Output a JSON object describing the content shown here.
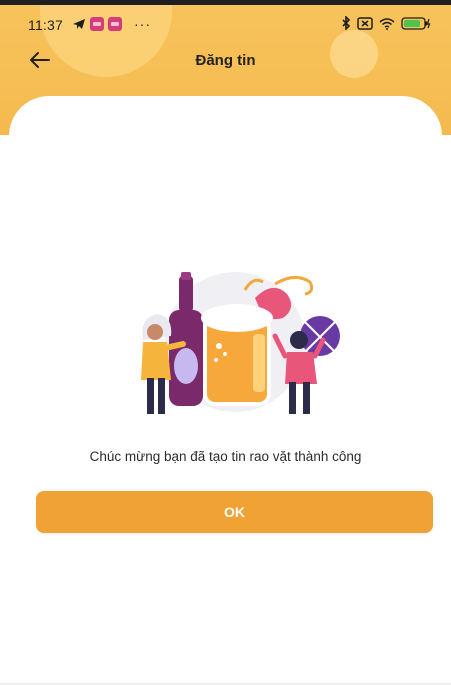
{
  "status_bar": {
    "time": "11:37",
    "overflow": "···",
    "icons_left": [
      "telegram-icon",
      "app-notification-icon",
      "app-notification-icon"
    ],
    "icons_right": [
      "bluetooth-icon",
      "close-box-icon",
      "wifi-icon",
      "battery-charging-icon"
    ]
  },
  "header": {
    "title": "Đăng tin",
    "back_icon": "arrow-left-icon"
  },
  "body": {
    "illustration": "celebration-illustration",
    "message": "Chúc mừng bạn đã tạo tin rao vặt thành công",
    "ok_label": "OK"
  },
  "colors": {
    "header_bg": "#f6bf55",
    "accent": "#f0a235",
    "text": "#222222",
    "button_text": "#ffffff"
  }
}
